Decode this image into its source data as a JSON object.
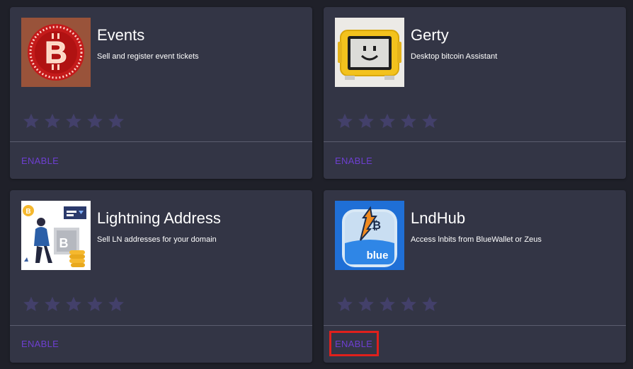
{
  "extensions": [
    {
      "title": "Events",
      "description": "Sell and register event tickets",
      "thumb_icon": "bitcoin-neon-sign-icon",
      "rating": 0,
      "action_label": "ENABLE"
    },
    {
      "title": "Gerty",
      "description": "Desktop bitcoin Assistant",
      "thumb_icon": "smiley-device-icon",
      "rating": 0,
      "action_label": "ENABLE"
    },
    {
      "title": "Lightning Address",
      "description": "Sell LN addresses for your domain",
      "thumb_icon": "person-with-bitcoin-icon",
      "rating": 0,
      "action_label": "ENABLE"
    },
    {
      "title": "LndHub",
      "description": "Access lnbits from BlueWallet or Zeus",
      "thumb_icon": "bluewallet-bitcoin-icon",
      "thumb_text": "blue",
      "rating": 0,
      "action_label": "ENABLE",
      "highlighted": true
    }
  ],
  "colors": {
    "background": "#1f2029",
    "card": "#333545",
    "accent": "#6d3fd0",
    "star_empty": "#43406a",
    "highlight": "#e0201c"
  }
}
